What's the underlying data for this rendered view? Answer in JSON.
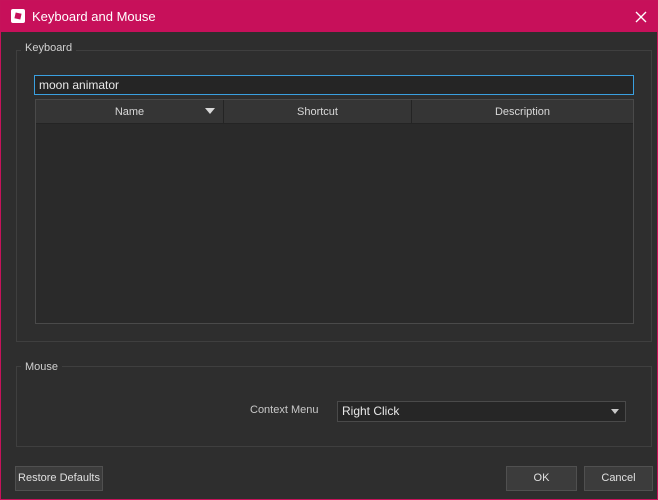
{
  "window": {
    "title": "Keyboard and Mouse"
  },
  "keyboard": {
    "legend": "Keyboard",
    "search_value": "moon animator",
    "columns": [
      "Name",
      "Shortcut",
      "Description"
    ],
    "rows": []
  },
  "mouse": {
    "legend": "Mouse",
    "context_menu_label": "Context Menu",
    "context_menu_value": "Right Click"
  },
  "buttons": {
    "restore_defaults": "Restore Defaults",
    "ok": "OK",
    "cancel": "Cancel"
  },
  "colors": {
    "titlebar": "#c7105a",
    "accent_focus": "#3aa0e0",
    "background": "#2e2e2e"
  },
  "icons": {
    "app": "app-logo-icon",
    "close": "close-icon",
    "sort": "sort-descending-icon",
    "dropdown": "chevron-down-icon"
  }
}
